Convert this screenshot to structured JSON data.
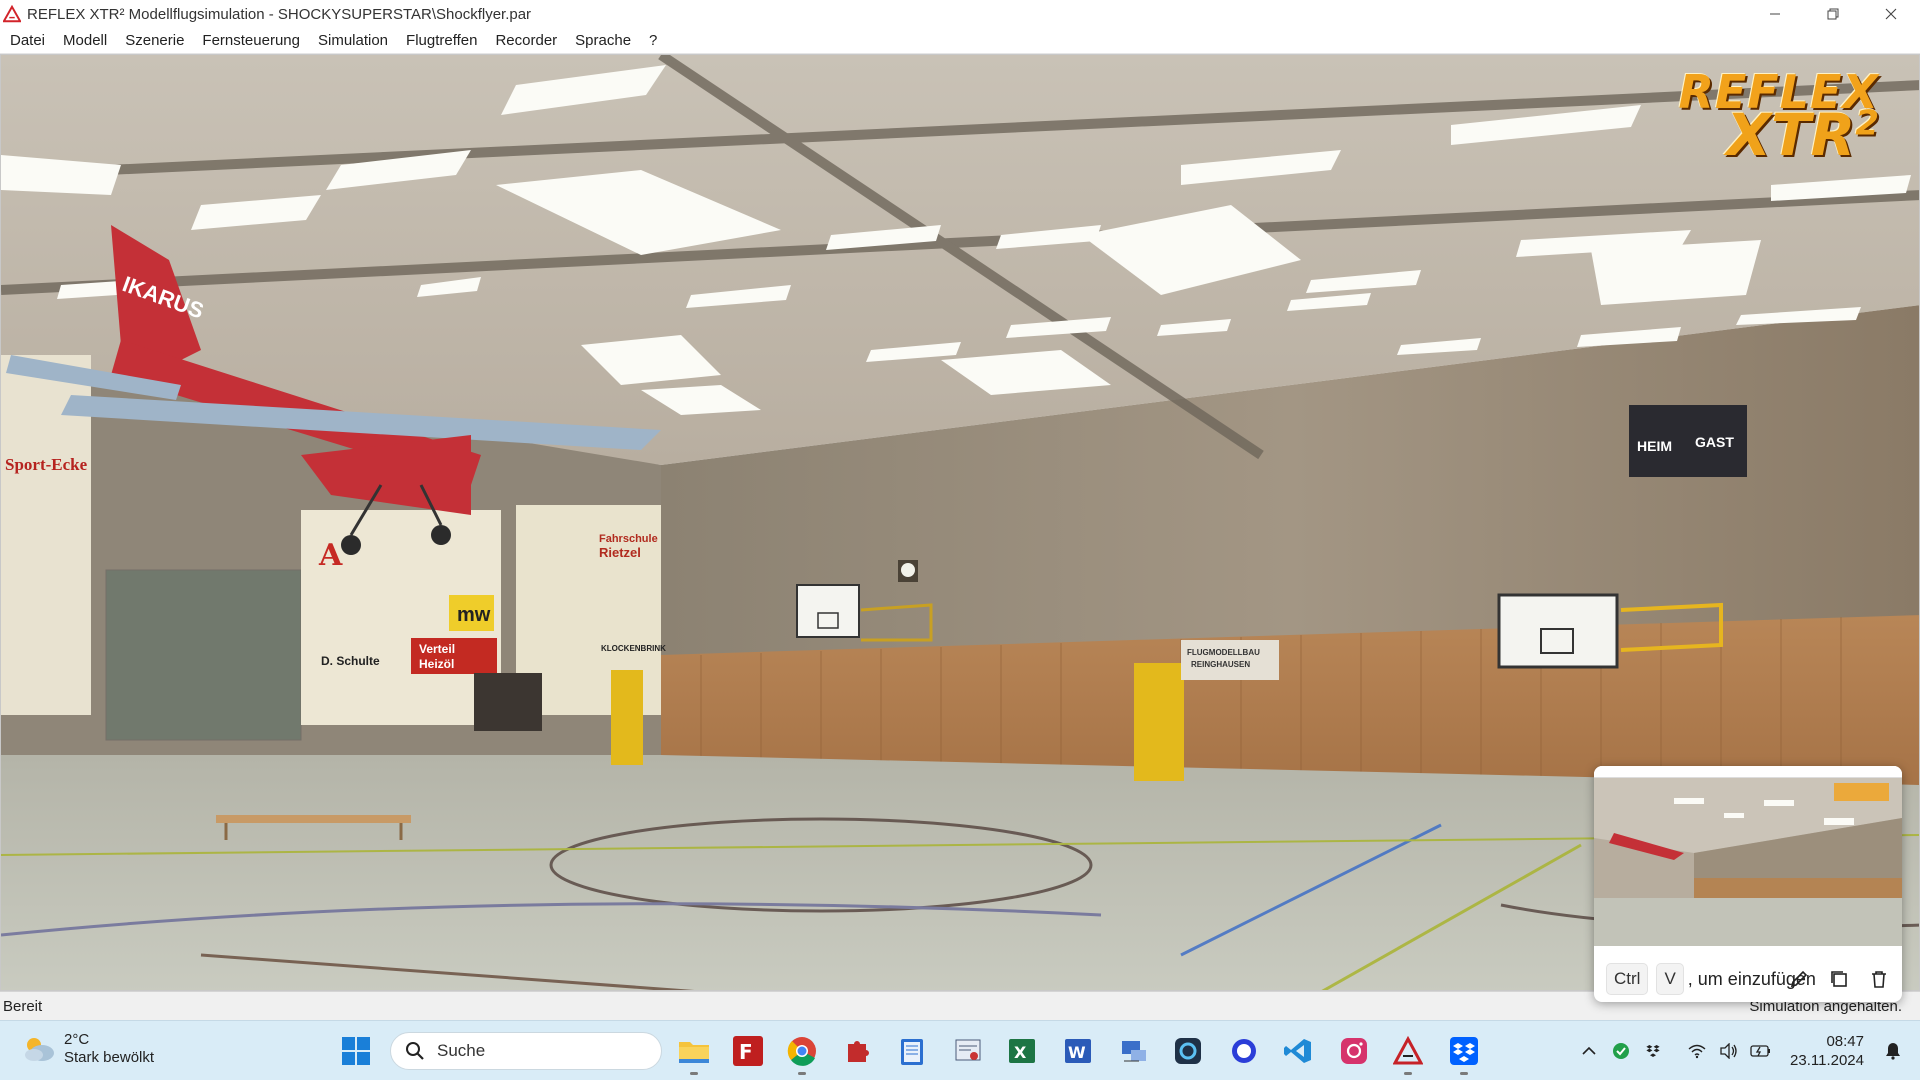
{
  "window": {
    "title": "REFLEX XTR² Modellflugsimulation - SHOCKYSUPERSTAR\\Shockflyer.par",
    "minimize_icon": "minimize-icon",
    "maximize_icon": "restore-icon",
    "close_icon": "close-icon"
  },
  "menu": {
    "items": [
      "Datei",
      "Modell",
      "Szenerie",
      "Fernsteuerung",
      "Simulation",
      "Flugtreffen",
      "Recorder",
      "Sprache",
      "?"
    ]
  },
  "scene": {
    "logo_line1": "REFLEX",
    "logo_line2": "XTR",
    "logo_sup": "2",
    "banner_sport": "Sport-Ecke",
    "banner_heim": "HEIM",
    "banner_gast": "GAST",
    "sign_d_schulte": "D. Schulte",
    "sign_verteil": "Verteil",
    "sign_heizol": "Heizöl",
    "sign_fahrschule": "Fahrschule",
    "sign_rietzel": "Rietzel",
    "sign_klocken": "KLOCKENBRINK",
    "sign_modellbau": "FLUGMODELLBAU",
    "sign_modellbau2": "REINGHAUSEN",
    "sign_mw": "mw",
    "sign_apotheke": "A",
    "plane_text": "IKARUS"
  },
  "status": {
    "left": "Bereit",
    "right": "Simulation angehalten."
  },
  "clipboard": {
    "key1": "Ctrl",
    "key2": "V",
    "text": ", um einzufügen",
    "actions": [
      "pen-icon",
      "copy-icon",
      "trash-icon"
    ]
  },
  "taskbar": {
    "weather_temp": "2°C",
    "weather_desc": "Stark bewölkt",
    "search_placeholder": "Suche",
    "apps": [
      "file-explorer-icon",
      "filezilla-icon",
      "chrome-icon",
      "puzzle-app-icon",
      "notepad-icon",
      "certificate-app-icon",
      "excel-icon",
      "word-icon",
      "network-app-icon",
      "camera-app-icon",
      "cortana-ring-icon",
      "vscode-icon",
      "instagram-icon",
      "reflex-xtr-icon",
      "dropbox-icon"
    ],
    "time": "08:47",
    "date": "23.11.2024"
  },
  "colors": {
    "taskbar_bg": "#d9ecf7",
    "accent_blue": "#0067c0",
    "logo_orange": "#f2a21b"
  }
}
